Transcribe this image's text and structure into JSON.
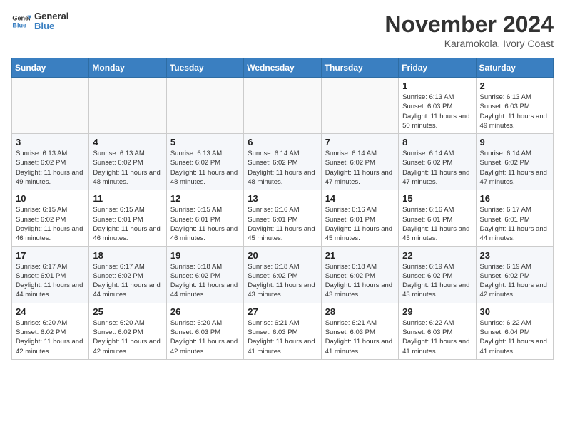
{
  "header": {
    "logo_line1": "General",
    "logo_line2": "Blue",
    "month_year": "November 2024",
    "location": "Karamokola, Ivory Coast"
  },
  "weekdays": [
    "Sunday",
    "Monday",
    "Tuesday",
    "Wednesday",
    "Thursday",
    "Friday",
    "Saturday"
  ],
  "weeks": [
    [
      {
        "day": "",
        "info": ""
      },
      {
        "day": "",
        "info": ""
      },
      {
        "day": "",
        "info": ""
      },
      {
        "day": "",
        "info": ""
      },
      {
        "day": "",
        "info": ""
      },
      {
        "day": "1",
        "info": "Sunrise: 6:13 AM\nSunset: 6:03 PM\nDaylight: 11 hours and 50 minutes."
      },
      {
        "day": "2",
        "info": "Sunrise: 6:13 AM\nSunset: 6:03 PM\nDaylight: 11 hours and 49 minutes."
      }
    ],
    [
      {
        "day": "3",
        "info": "Sunrise: 6:13 AM\nSunset: 6:02 PM\nDaylight: 11 hours and 49 minutes."
      },
      {
        "day": "4",
        "info": "Sunrise: 6:13 AM\nSunset: 6:02 PM\nDaylight: 11 hours and 48 minutes."
      },
      {
        "day": "5",
        "info": "Sunrise: 6:13 AM\nSunset: 6:02 PM\nDaylight: 11 hours and 48 minutes."
      },
      {
        "day": "6",
        "info": "Sunrise: 6:14 AM\nSunset: 6:02 PM\nDaylight: 11 hours and 48 minutes."
      },
      {
        "day": "7",
        "info": "Sunrise: 6:14 AM\nSunset: 6:02 PM\nDaylight: 11 hours and 47 minutes."
      },
      {
        "day": "8",
        "info": "Sunrise: 6:14 AM\nSunset: 6:02 PM\nDaylight: 11 hours and 47 minutes."
      },
      {
        "day": "9",
        "info": "Sunrise: 6:14 AM\nSunset: 6:02 PM\nDaylight: 11 hours and 47 minutes."
      }
    ],
    [
      {
        "day": "10",
        "info": "Sunrise: 6:15 AM\nSunset: 6:02 PM\nDaylight: 11 hours and 46 minutes."
      },
      {
        "day": "11",
        "info": "Sunrise: 6:15 AM\nSunset: 6:01 PM\nDaylight: 11 hours and 46 minutes."
      },
      {
        "day": "12",
        "info": "Sunrise: 6:15 AM\nSunset: 6:01 PM\nDaylight: 11 hours and 46 minutes."
      },
      {
        "day": "13",
        "info": "Sunrise: 6:16 AM\nSunset: 6:01 PM\nDaylight: 11 hours and 45 minutes."
      },
      {
        "day": "14",
        "info": "Sunrise: 6:16 AM\nSunset: 6:01 PM\nDaylight: 11 hours and 45 minutes."
      },
      {
        "day": "15",
        "info": "Sunrise: 6:16 AM\nSunset: 6:01 PM\nDaylight: 11 hours and 45 minutes."
      },
      {
        "day": "16",
        "info": "Sunrise: 6:17 AM\nSunset: 6:01 PM\nDaylight: 11 hours and 44 minutes."
      }
    ],
    [
      {
        "day": "17",
        "info": "Sunrise: 6:17 AM\nSunset: 6:01 PM\nDaylight: 11 hours and 44 minutes."
      },
      {
        "day": "18",
        "info": "Sunrise: 6:17 AM\nSunset: 6:02 PM\nDaylight: 11 hours and 44 minutes."
      },
      {
        "day": "19",
        "info": "Sunrise: 6:18 AM\nSunset: 6:02 PM\nDaylight: 11 hours and 44 minutes."
      },
      {
        "day": "20",
        "info": "Sunrise: 6:18 AM\nSunset: 6:02 PM\nDaylight: 11 hours and 43 minutes."
      },
      {
        "day": "21",
        "info": "Sunrise: 6:18 AM\nSunset: 6:02 PM\nDaylight: 11 hours and 43 minutes."
      },
      {
        "day": "22",
        "info": "Sunrise: 6:19 AM\nSunset: 6:02 PM\nDaylight: 11 hours and 43 minutes."
      },
      {
        "day": "23",
        "info": "Sunrise: 6:19 AM\nSunset: 6:02 PM\nDaylight: 11 hours and 42 minutes."
      }
    ],
    [
      {
        "day": "24",
        "info": "Sunrise: 6:20 AM\nSunset: 6:02 PM\nDaylight: 11 hours and 42 minutes."
      },
      {
        "day": "25",
        "info": "Sunrise: 6:20 AM\nSunset: 6:02 PM\nDaylight: 11 hours and 42 minutes."
      },
      {
        "day": "26",
        "info": "Sunrise: 6:20 AM\nSunset: 6:03 PM\nDaylight: 11 hours and 42 minutes."
      },
      {
        "day": "27",
        "info": "Sunrise: 6:21 AM\nSunset: 6:03 PM\nDaylight: 11 hours and 41 minutes."
      },
      {
        "day": "28",
        "info": "Sunrise: 6:21 AM\nSunset: 6:03 PM\nDaylight: 11 hours and 41 minutes."
      },
      {
        "day": "29",
        "info": "Sunrise: 6:22 AM\nSunset: 6:03 PM\nDaylight: 11 hours and 41 minutes."
      },
      {
        "day": "30",
        "info": "Sunrise: 6:22 AM\nSunset: 6:04 PM\nDaylight: 11 hours and 41 minutes."
      }
    ]
  ]
}
